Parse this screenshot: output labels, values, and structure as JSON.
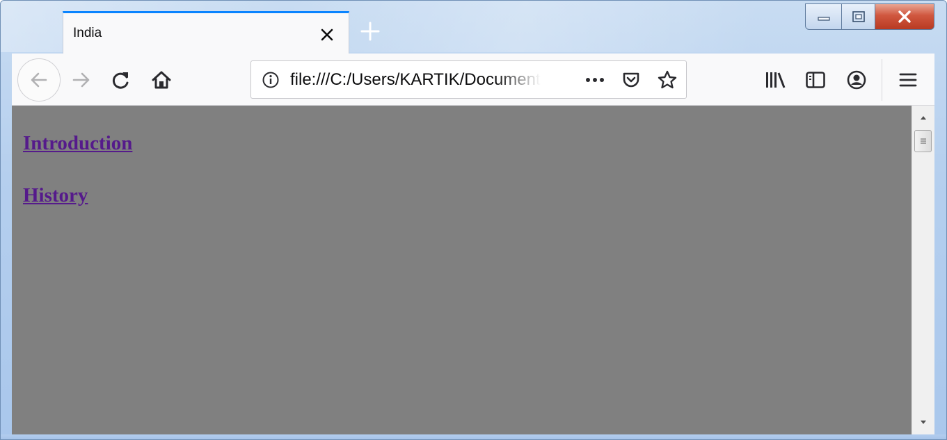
{
  "window": {
    "controls": {
      "minimize": "minimize-icon",
      "maximize": "maximize-icon",
      "close": "close-icon"
    }
  },
  "tabs": [
    {
      "title": "India",
      "active": true,
      "close_icon": "close-icon"
    }
  ],
  "new_tab_icon": "plus-icon",
  "toolbar": {
    "icons": [
      "back-arrow-icon",
      "forward-arrow-icon",
      "reload-icon",
      "home-icon"
    ],
    "url": "file:///C:/Users/KARTIK/Documents/",
    "url_bar_icons": [
      "info-icon",
      "page-actions-ellipsis-icon",
      "pocket-icon",
      "bookmark-star-icon"
    ],
    "right_icons": [
      "library-icon",
      "sidebar-icon",
      "account-icon",
      "hamburger-menu-icon"
    ]
  },
  "page": {
    "background": "#808080",
    "link_color": "#551a8b",
    "links": [
      "Introduction",
      "History"
    ]
  },
  "colors": {
    "active_tab_accent": "#0a84ff",
    "toolbar_bg": "#f9f9fa",
    "close_button": "#c94a33"
  }
}
